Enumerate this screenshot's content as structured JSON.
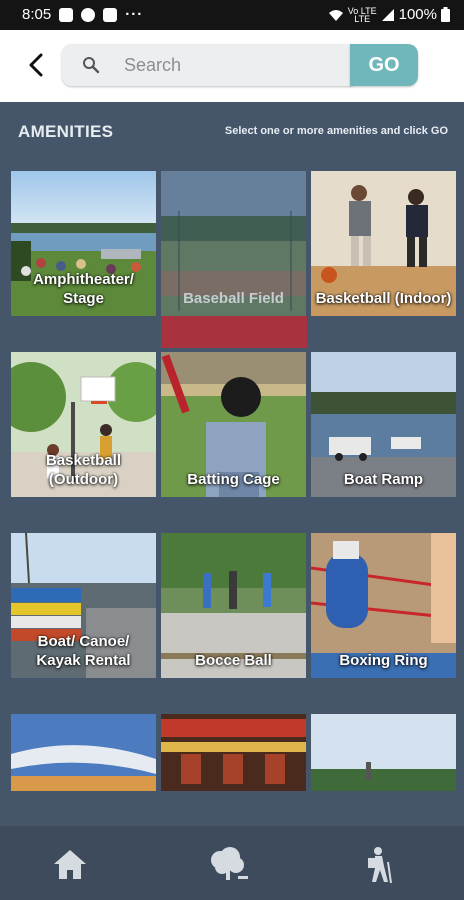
{
  "status": {
    "time": "8:05",
    "battery": "100%",
    "network_top": "Vo LTE",
    "network_bottom": "LTE"
  },
  "search": {
    "placeholder": "Search",
    "go_label": "GO"
  },
  "section": {
    "title": "AMENITIES",
    "hint": "Select one or more amenities and click GO"
  },
  "amenities": [
    {
      "label": "Amphitheater/ Stage",
      "selected": false
    },
    {
      "label": "Baseball Field",
      "selected": true
    },
    {
      "label": "Basketball (Indoor)",
      "selected": false
    },
    {
      "label": "Basketball (Outdoor)",
      "selected": false
    },
    {
      "label": "Batting Cage",
      "selected": false
    },
    {
      "label": "Boat Ramp",
      "selected": false
    },
    {
      "label": "Boat/ Canoe/ Kayak Rental",
      "selected": false
    },
    {
      "label": "Bocce Ball",
      "selected": false
    },
    {
      "label": "Boxing Ring",
      "selected": false
    }
  ],
  "nav": [
    "home-icon",
    "tree-icon",
    "hiker-icon"
  ],
  "colors": {
    "accent": "#6fb7bb",
    "background": "#45566b",
    "selected": "#a8323d"
  }
}
